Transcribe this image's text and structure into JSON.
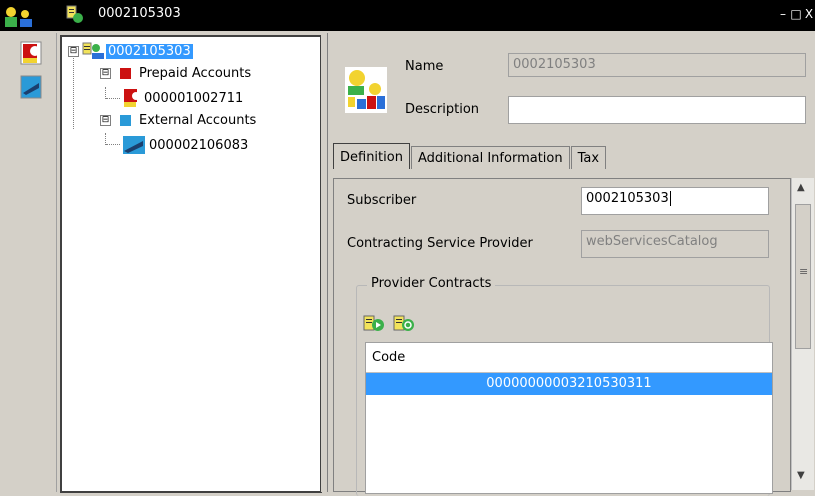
{
  "window": {
    "title": "0002105303",
    "controls": {
      "minimize": "–",
      "restore": "□",
      "close": "X"
    }
  },
  "tree": {
    "root": {
      "label": "0002105303",
      "expander": "⊟"
    },
    "groups": [
      {
        "label": "Prepaid Accounts",
        "expander": "⊟",
        "color": "#cc1111",
        "children": [
          {
            "label": "000001002711"
          }
        ]
      },
      {
        "label": "External Accounts",
        "expander": "⊟",
        "color": "#2a9ad8",
        "children": [
          {
            "label": "000002106083"
          }
        ]
      }
    ]
  },
  "form": {
    "name_label": "Name",
    "name_value": "0002105303",
    "description_label": "Description",
    "description_value": ""
  },
  "tabs": [
    {
      "label": "Definition",
      "active": true
    },
    {
      "label": "Additional Information",
      "active": false
    },
    {
      "label": "Tax",
      "active": false
    }
  ],
  "definition": {
    "subscriber_label": "Subscriber",
    "subscriber_value": "0002105303",
    "csp_label": "Contracting Service Provider",
    "csp_value": "webServicesCatalog",
    "provider_contracts": {
      "title": "Provider Contracts",
      "columns": [
        "Code"
      ],
      "rows": [
        {
          "code": "00000000003210530311",
          "selected": true
        }
      ]
    }
  },
  "scrollbar": {
    "up": "▲",
    "down": "▼",
    "grip": "≡"
  }
}
